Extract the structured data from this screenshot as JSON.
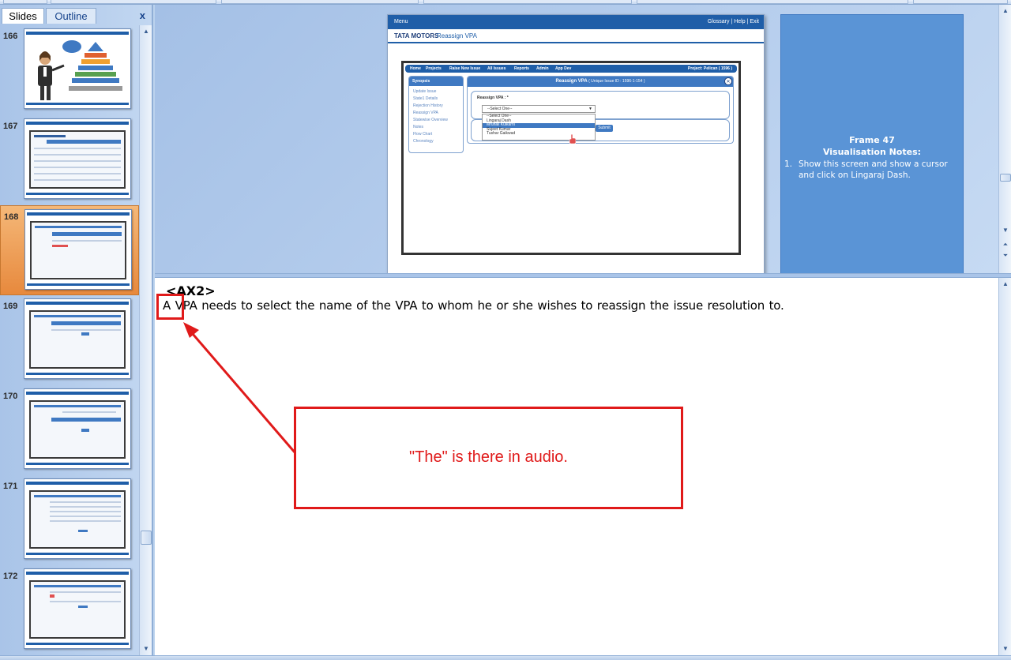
{
  "panel": {
    "tabs": [
      {
        "label": "Slides",
        "active": true
      },
      {
        "label": "Outline",
        "active": false
      }
    ],
    "close_glyph": "x"
  },
  "thumbnails": [
    {
      "number": "166",
      "selected": false,
      "style": "pyramid"
    },
    {
      "number": "167",
      "selected": false,
      "style": "table"
    },
    {
      "number": "168",
      "selected": true,
      "style": "dialog"
    },
    {
      "number": "169",
      "selected": false,
      "style": "dialog"
    },
    {
      "number": "170",
      "selected": false,
      "style": "dialog"
    },
    {
      "number": "171",
      "selected": false,
      "style": "form"
    },
    {
      "number": "172",
      "selected": false,
      "style": "form"
    }
  ],
  "slide": {
    "topbar": {
      "menu": "Menu",
      "links": "Glossary  |  Help  |  Exit"
    },
    "brand": "TATA MOTORS",
    "screen_title": "Reassign VPA",
    "nav_items": [
      "Home",
      "Projects",
      "Raise New Issue",
      "All Issues",
      "Reports",
      "Admin",
      "App Dev"
    ],
    "project_label": "Project: Pelican ( 1596 )",
    "synopsis": {
      "header": "Synopsis",
      "items": [
        "Update Issue",
        "State1 Details",
        "Rejection History",
        "Reassign VPA",
        "Statewise Overview",
        "Notes",
        "Flow Chart",
        "Chronology"
      ]
    },
    "dialog": {
      "title": "Reassign VPA",
      "subtitle": "( Unique Issue ID : 1596-1-154 )",
      "field_label": "Reassign VPA : *",
      "select_value": "--Select One--",
      "options": [
        "--Select One--",
        "Lingaraj Dash",
        "Mrunali Kulkarni",
        "Sujeet Kumar",
        "Tushar Gaikwad"
      ],
      "highlighted_option_index": 2,
      "submit": "Submit"
    }
  },
  "visualisation": {
    "frame": "Frame 47",
    "heading": "Visualisation Notes:",
    "items": [
      {
        "num": "1.",
        "text": "Show this screen and show a cursor and click on Lingaraj Dash."
      }
    ]
  },
  "notes": {
    "title": "<AX2>",
    "body": "A VPA needs to select the name of the VPA to whom he or she wishes to reassign the issue resolution to.",
    "callout": "\"The\" is there in audio."
  },
  "colors": {
    "annotation": "#e01a1a",
    "slide_blue": "#1f5ea8",
    "notes_box": "#5a94d6",
    "selected_thumb": "#e7893d"
  }
}
